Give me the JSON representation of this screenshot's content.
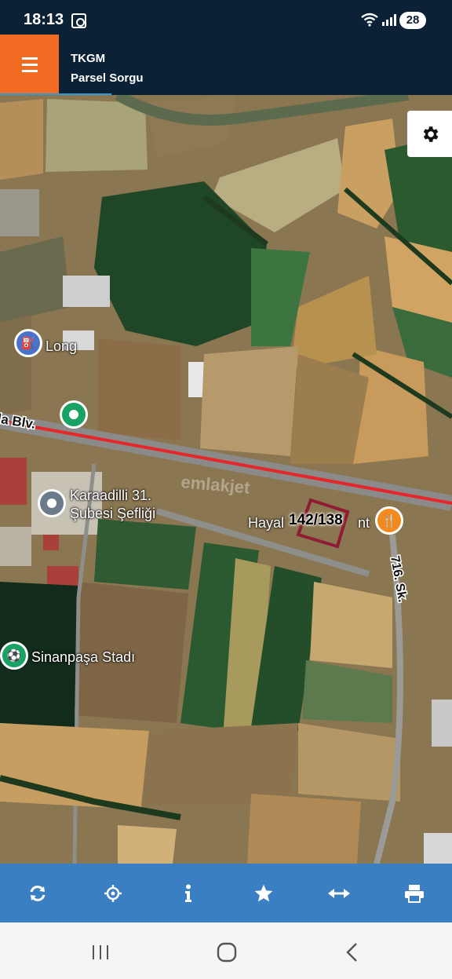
{
  "status_bar": {
    "time": "18:13",
    "battery_level": "28"
  },
  "header": {
    "title": "TKGM",
    "subtitle": "Parsel Sorgu"
  },
  "map": {
    "road_label": "la Blv.",
    "street_label": "716. Sk.",
    "watermark": "emlakjet",
    "parcel_label": "142/138",
    "pois": [
      {
        "label": "Long",
        "icon": "fuel-pump-icon"
      },
      {
        "label": "Karaadilli 31. Şubesi Şefliği",
        "label_line1": "Karaadilli 31.",
        "label_line2": "Şubesi Şefliği",
        "icon": "location-pin-icon"
      },
      {
        "label": "Hayal",
        "label_suffix": "nt",
        "icon": "restaurant-icon"
      },
      {
        "label": "Sinanpaşa Stadı",
        "icon": "stadium-icon"
      }
    ]
  },
  "toolbar": {
    "items": [
      "refresh-icon",
      "locate-icon",
      "info-icon",
      "star-icon",
      "measure-icon",
      "print-icon"
    ]
  },
  "colors": {
    "header_bg": "#0b2135",
    "menu_accent": "#f26b22",
    "toolbar_bg": "#3a7fc1",
    "parcel_outline": "#8e1c33",
    "road_highlight": "#e5262b",
    "poi_green": "#18a364",
    "poi_blue": "#4b72c9",
    "poi_gray": "#6b7b8a",
    "poi_orange": "#f28a1f"
  }
}
